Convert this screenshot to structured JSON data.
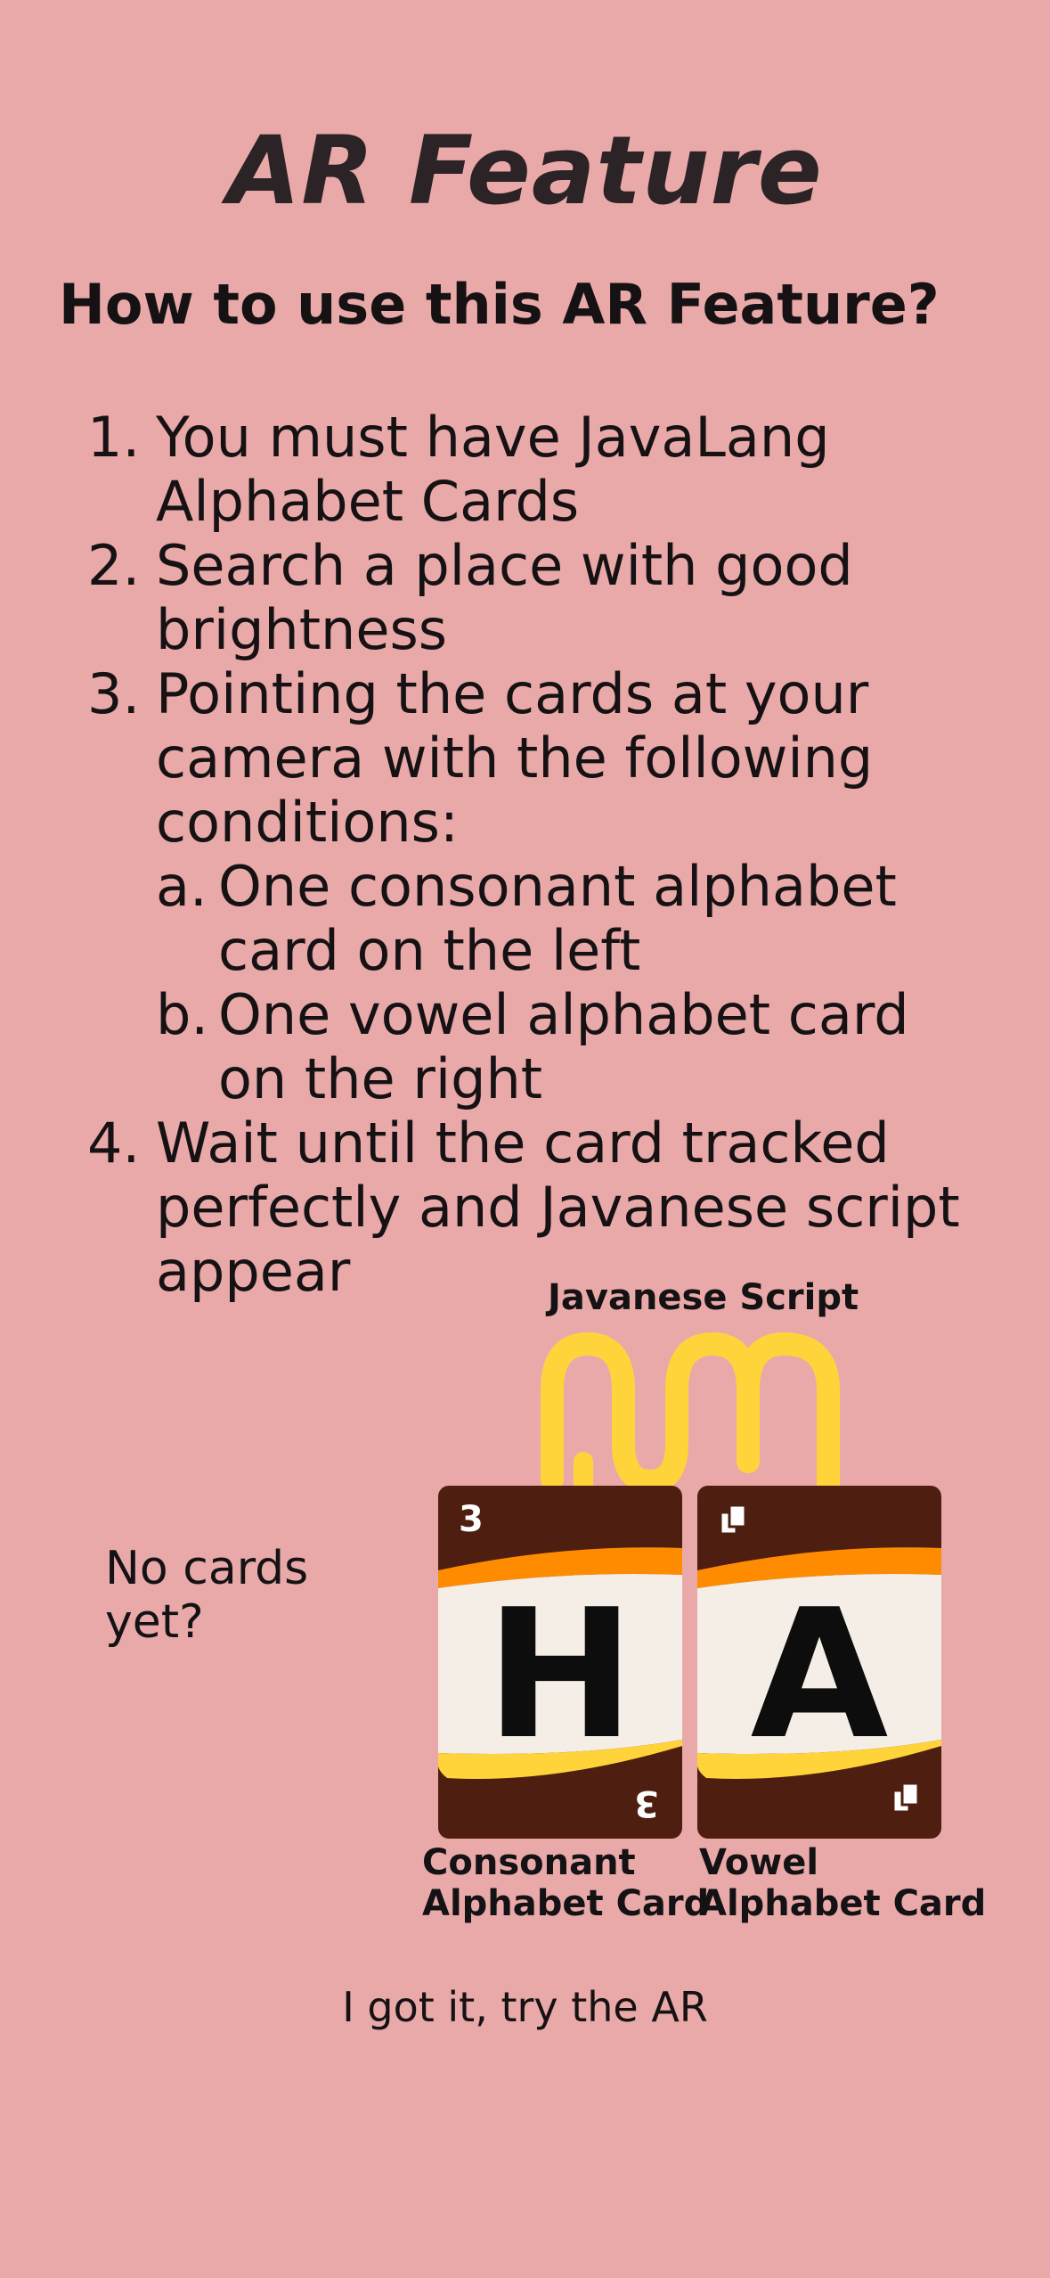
{
  "title": "AR Feature",
  "subtitle": "How to use this AR Feature?",
  "steps": [
    {
      "num": "1.",
      "text": "You must have JavaLang\nAlphabet Cards"
    },
    {
      "num": "2.",
      "text": "Search a place with good\nbrightness"
    },
    {
      "num": "3.",
      "text": "Pointing the cards at your\ncamera with the following\nconditions:"
    },
    {
      "num": "4.",
      "text": "Wait until the card tracked\nperfectly and Javanese script\nappear"
    }
  ],
  "substeps": [
    {
      "letter": "a.",
      "text": "One consonant alphabet\ncard on the left"
    },
    {
      "letter": "b.",
      "text": "One vowel alphabet card\non the right"
    }
  ],
  "illustration": {
    "script_label": "Javanese Script",
    "no_cards": "No cards\nyet?",
    "consonant_card": {
      "letter": "H",
      "corner_number": "3",
      "caption": "Consonant\nAlphabet Card"
    },
    "vowel_card": {
      "letter": "A",
      "caption": "Vowel\nAlphabet Card"
    }
  },
  "cta_label": "I got it, try the AR",
  "colors": {
    "background": "#e9a9a9",
    "card_brown": "#4e1f10",
    "card_cream": "#f4eee6",
    "card_orange": "#ff8c00",
    "card_yellow": "#ffd43b",
    "script_yellow": "#ffd43b"
  }
}
